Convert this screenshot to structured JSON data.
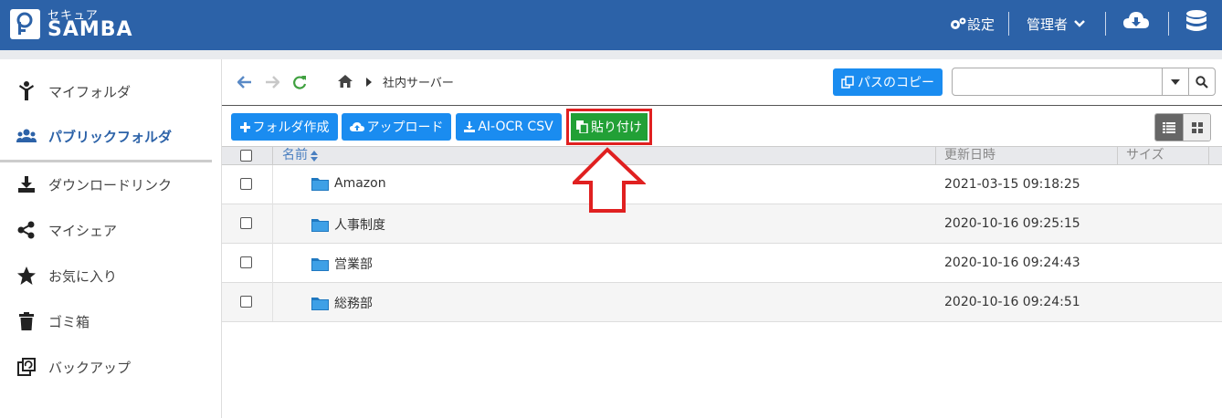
{
  "app": {
    "logo_small": "セキュア",
    "logo_big": "SAMBA",
    "settings_label": "設定",
    "admin_label": "管理者"
  },
  "sidebar": {
    "items": [
      {
        "label": "マイフォルダ",
        "icon": "person-icon"
      },
      {
        "label": "パブリックフォルダ",
        "icon": "users-icon",
        "active": true
      },
      {
        "label": "ダウンロードリンク",
        "icon": "download-icon"
      },
      {
        "label": "マイシェア",
        "icon": "share-icon"
      },
      {
        "label": "お気に入り",
        "icon": "star-icon"
      },
      {
        "label": "ゴミ箱",
        "icon": "trash-icon"
      },
      {
        "label": "バックアップ",
        "icon": "backup-icon"
      }
    ]
  },
  "breadcrumb": {
    "current": "社内サーバー"
  },
  "toolbar": {
    "copy_path_label": "パスのコピー",
    "search_value": "",
    "new_folder_label": "フォルダ作成",
    "upload_label": "アップロード",
    "ocr_label": "AI-OCR CSV",
    "paste_label": "貼り付け"
  },
  "table": {
    "columns": {
      "name": "名前",
      "modified": "更新日時",
      "size": "サイズ"
    },
    "rows": [
      {
        "name": "Amazon",
        "modified": "2021-03-15 09:18:25",
        "size": ""
      },
      {
        "name": "人事制度",
        "modified": "2020-10-16 09:25:15",
        "size": ""
      },
      {
        "name": "営業部",
        "modified": "2020-10-16 09:24:43",
        "size": ""
      },
      {
        "name": "総務部",
        "modified": "2020-10-16 09:24:51",
        "size": ""
      }
    ]
  },
  "colors": {
    "header_bg": "#2c62a8",
    "primary_button": "#1a8cf0",
    "paste_button": "#22a036",
    "highlight": "#e02020"
  }
}
